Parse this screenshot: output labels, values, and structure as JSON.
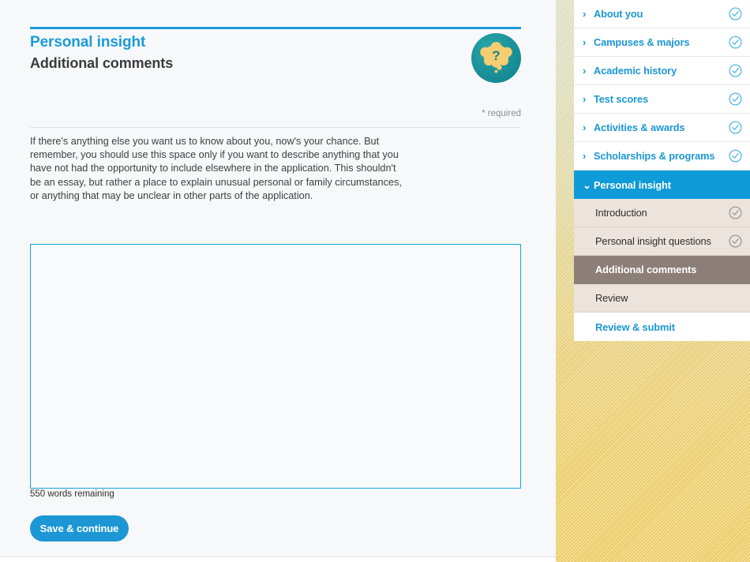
{
  "header": {
    "eyebrow": "Personal insight",
    "title": "Additional comments",
    "required_note": "* required",
    "badge_icon": "question-thought-bubble-icon"
  },
  "main": {
    "instructions": "If there's anything else you want us to know about you, now's your chance. But remember, you should use this space only if you want to describe anything that you have not had the opportunity to include elsewhere in the application. This shouldn't be an essay, but rather a place to explain unusual personal or family circumstances, or anything that may be unclear in other parts of the application.",
    "comments_value": "",
    "comments_placeholder": "",
    "word_count": "550 words remaining",
    "save_label": "Save & continue"
  },
  "sidebar": {
    "items": [
      {
        "label": "About you",
        "state": "collapsed",
        "chevron": "chevron-right-icon",
        "check": "check-circle-blue-icon"
      },
      {
        "label": "Campuses & majors",
        "state": "collapsed",
        "chevron": "chevron-right-icon",
        "check": "check-circle-blue-icon"
      },
      {
        "label": "Academic history",
        "state": "collapsed",
        "chevron": "chevron-right-icon",
        "check": "check-circle-blue-icon"
      },
      {
        "label": "Test scores",
        "state": "collapsed",
        "chevron": "chevron-right-icon",
        "check": "check-circle-blue-icon"
      },
      {
        "label": "Activities & awards",
        "state": "collapsed",
        "chevron": "chevron-right-icon",
        "check": "check-circle-blue-icon"
      },
      {
        "label": "Scholarships & programs",
        "state": "collapsed",
        "chevron": "chevron-right-icon",
        "check": "check-circle-blue-icon"
      },
      {
        "label": "Personal insight",
        "state": "expanded",
        "chevron": "chevron-down-icon",
        "check": ""
      }
    ],
    "subitems": [
      {
        "label": "Introduction",
        "state": "visited",
        "check": "check-circle-grey-icon"
      },
      {
        "label": "Personal insight questions",
        "state": "visited",
        "check": "check-circle-grey-icon"
      },
      {
        "label": "Additional comments",
        "state": "active",
        "check": ""
      },
      {
        "label": "Review",
        "state": "visited",
        "check": ""
      },
      {
        "label": "Review & submit",
        "state": "link",
        "check": ""
      }
    ]
  },
  "colors": {
    "accent_blue": "#1c96d4",
    "title_blue": "#1a9bd7",
    "active_nav_blue": "#0f9ad8",
    "active_subitem_brown": "#8c7e78",
    "subitem_beige": "#ece3dd",
    "badge_teal": "#1a9099",
    "badge_gold": "#f3cd6d",
    "panel_bg": "#f7f8fa",
    "page_gradient_top": "#dde0c3",
    "page_gradient_bottom": "#eccb62"
  }
}
